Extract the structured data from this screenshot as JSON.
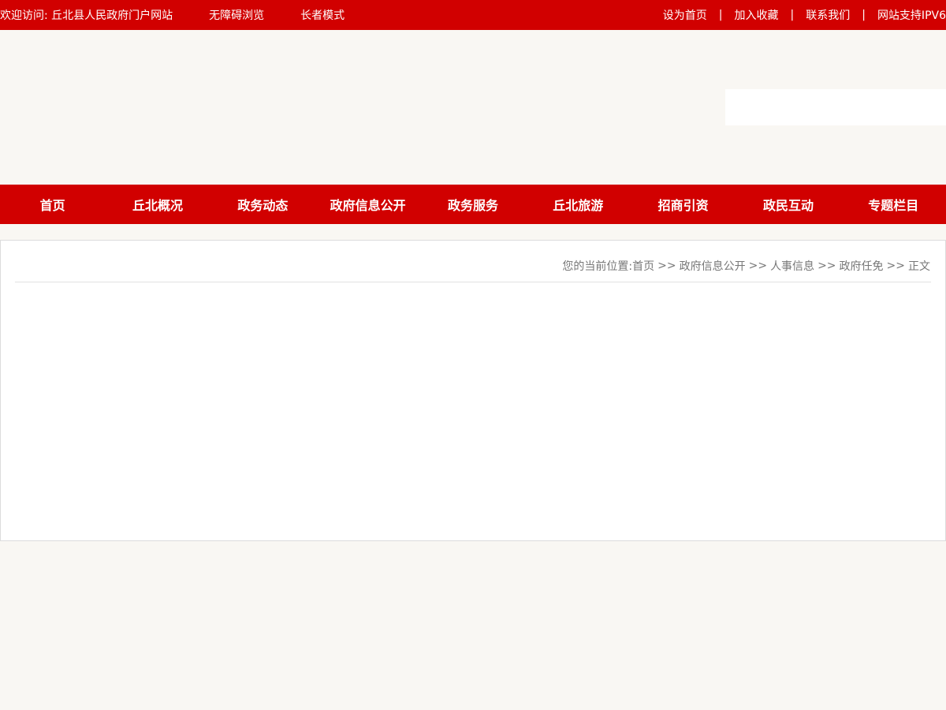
{
  "topbar": {
    "welcome": "欢迎访问:  丘北县人民政府门户网站",
    "accessible": "无障碍浏览",
    "elder_mode": "长者模式",
    "set_home": "设为首页",
    "add_favorite": "加入收藏",
    "contact_us": "联系我们",
    "ipv6": "网站支持IPV6",
    "separator": "|"
  },
  "mainnav": {
    "items": [
      {
        "label": "首页"
      },
      {
        "label": "丘北概况"
      },
      {
        "label": "政务动态"
      },
      {
        "label": "政府信息公开"
      },
      {
        "label": "政务服务"
      },
      {
        "label": "丘北旅游"
      },
      {
        "label": "招商引资"
      },
      {
        "label": "政民互动"
      },
      {
        "label": "专题栏目"
      }
    ]
  },
  "breadcrumb": {
    "prefix": "您的当前位置: ",
    "separator": ">>",
    "items": [
      "首页",
      "政府信息公开",
      "人事信息",
      "政府任免",
      "正文"
    ]
  },
  "colors": {
    "brand_red": "#d10000",
    "page_bg": "#f9f7f3",
    "breadcrumb_text": "#777777"
  }
}
